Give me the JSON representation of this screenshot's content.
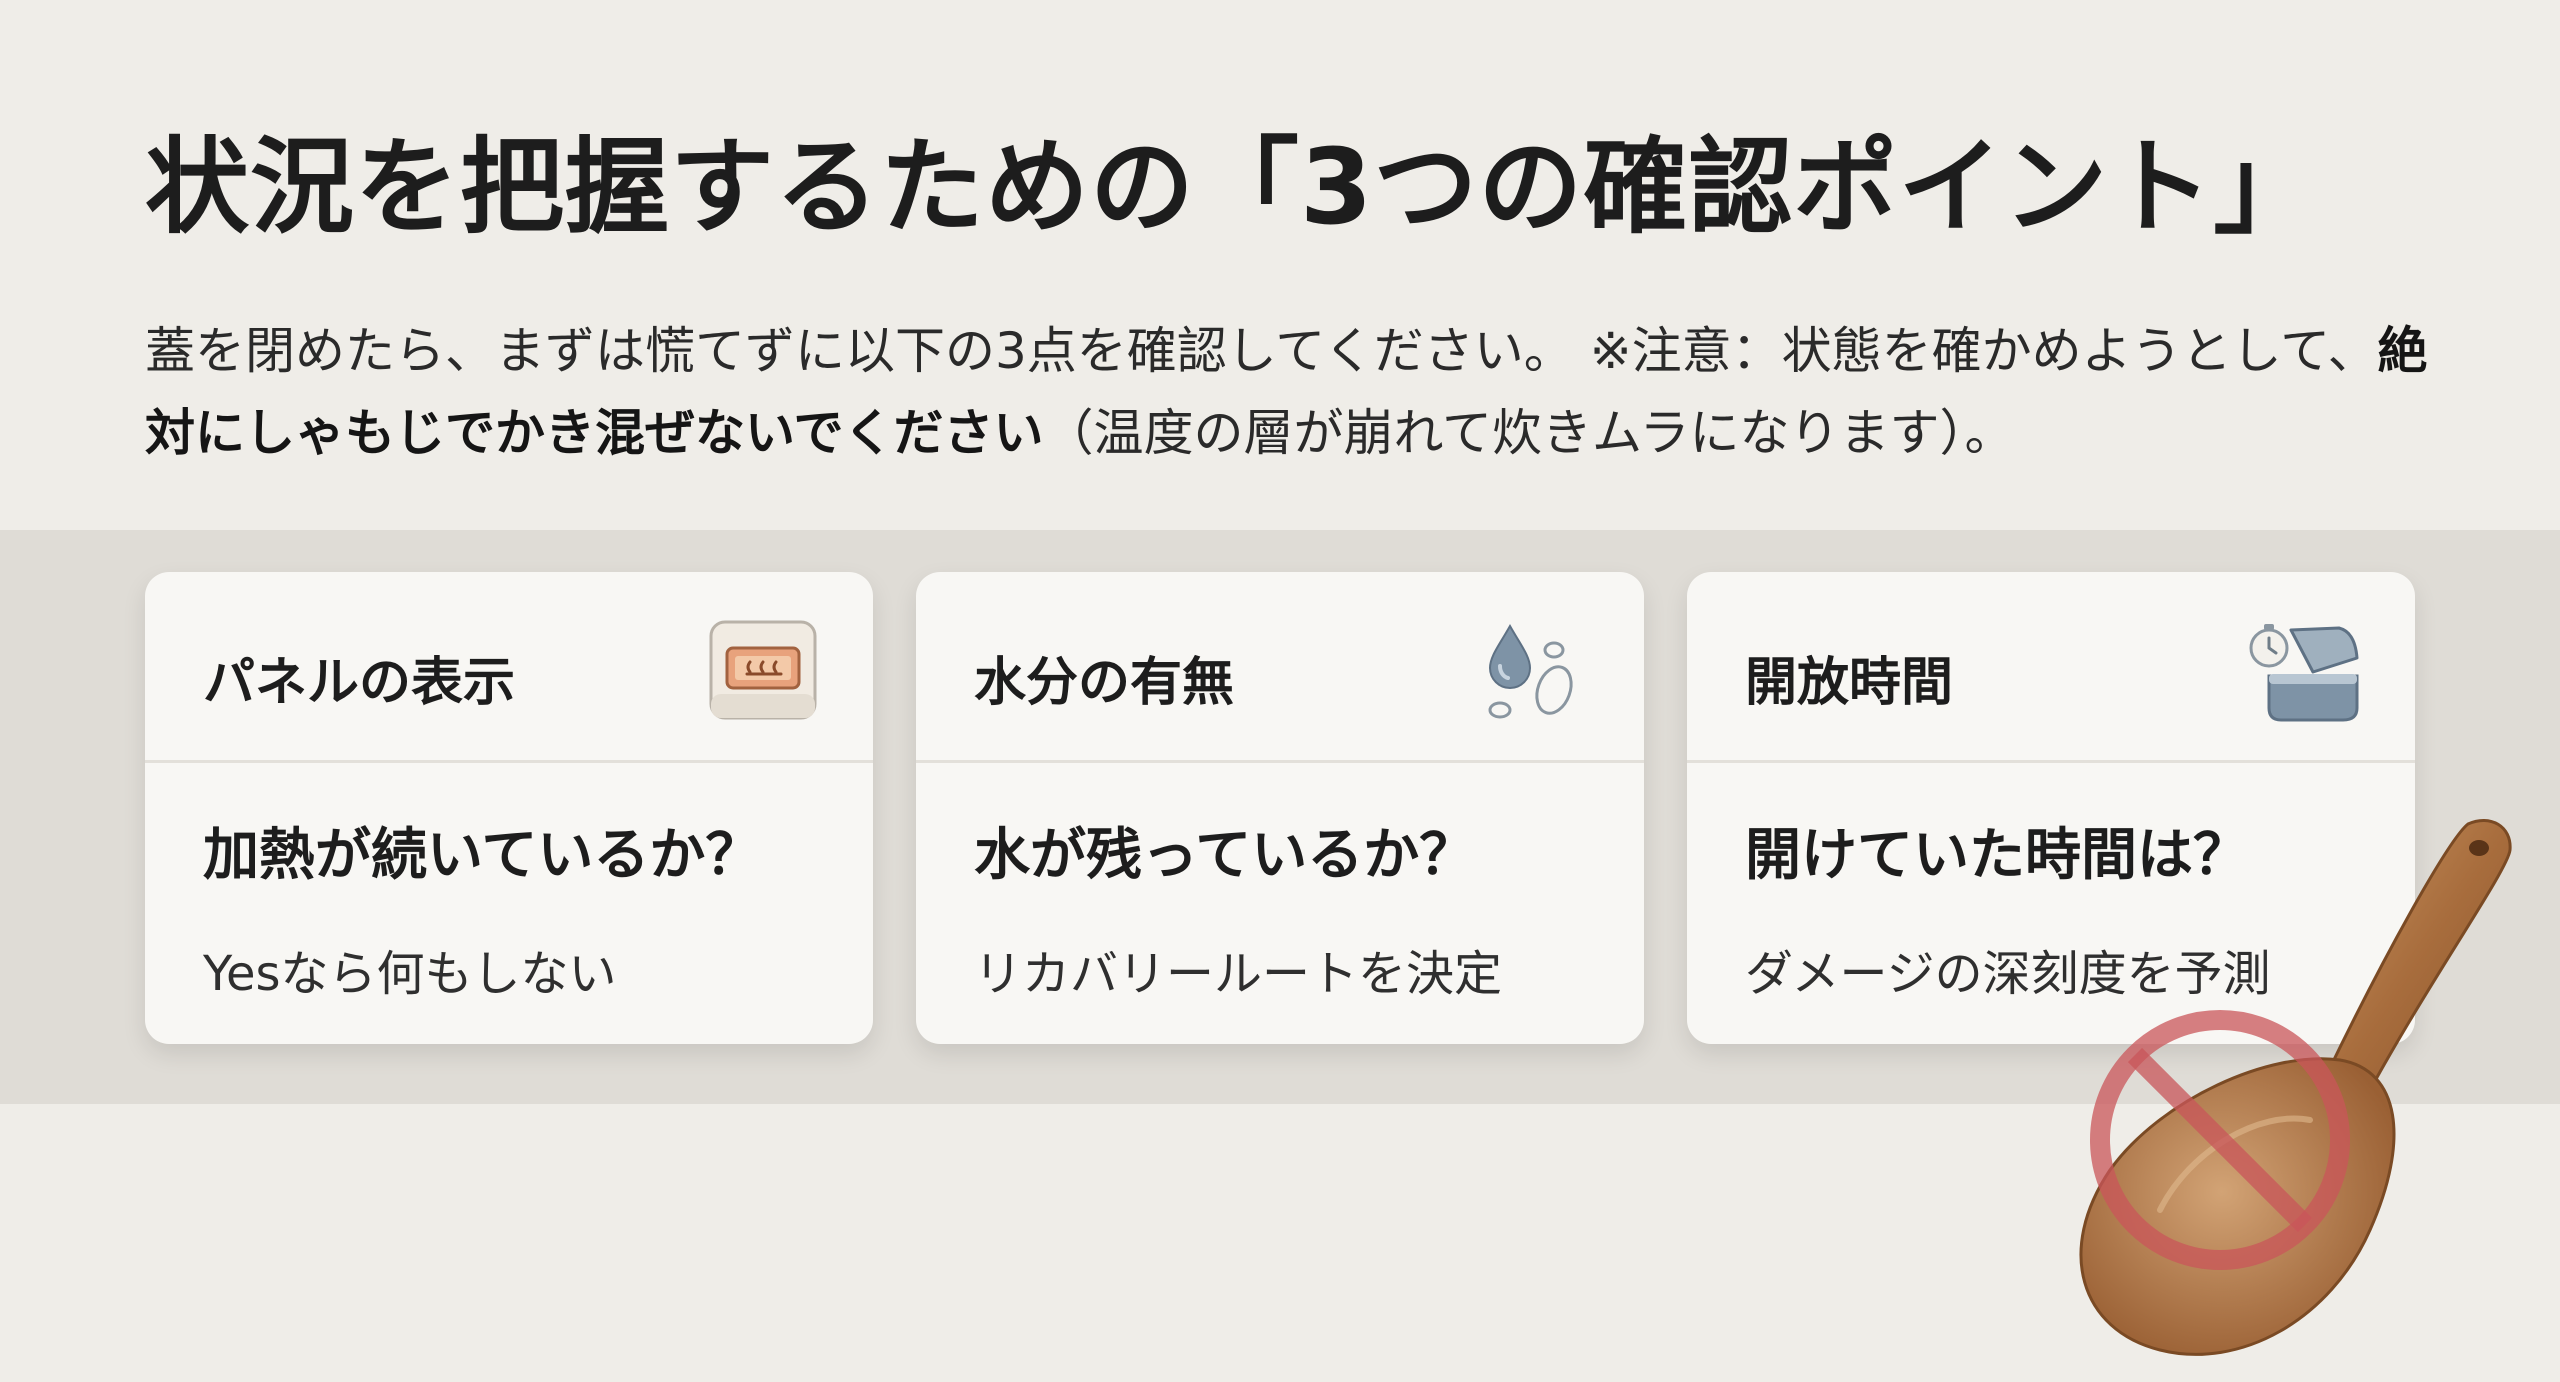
{
  "title": "状況を把握するための「3つの確認ポイント」",
  "intro": {
    "lead": "蓋を閉めたら、まずは慌てずに以下の3点を確認してください。 ※注意：状態を確かめようとして、",
    "emphasis": "絶対にしゃもじでかき混ぜないでください",
    "tail": "（温度の層が崩れて炊きムラになります）。"
  },
  "cards": [
    {
      "title": "パネルの表示",
      "icon": "rice-cooker-panel-icon",
      "question": "加熱が続いているか？",
      "answer": "Yesなら何もしない"
    },
    {
      "title": "水分の有無",
      "icon": "water-drops-icon",
      "question": "水が残っているか？",
      "answer": "リカバリールートを決定"
    },
    {
      "title": "開放時間",
      "icon": "timer-open-lid-icon",
      "question": "開けていた時間は？",
      "answer": "ダメージの深刻度を予測"
    }
  ],
  "colors": {
    "background": "#efede8",
    "band": "#dfdcd6",
    "card": "#f8f7f4",
    "prohibition": "#c9565a",
    "wood": "#b07a4a",
    "icon_blue": "#7e93a6"
  },
  "decoration": {
    "spoon_icon": "wooden-rice-paddle-prohibited-icon"
  }
}
